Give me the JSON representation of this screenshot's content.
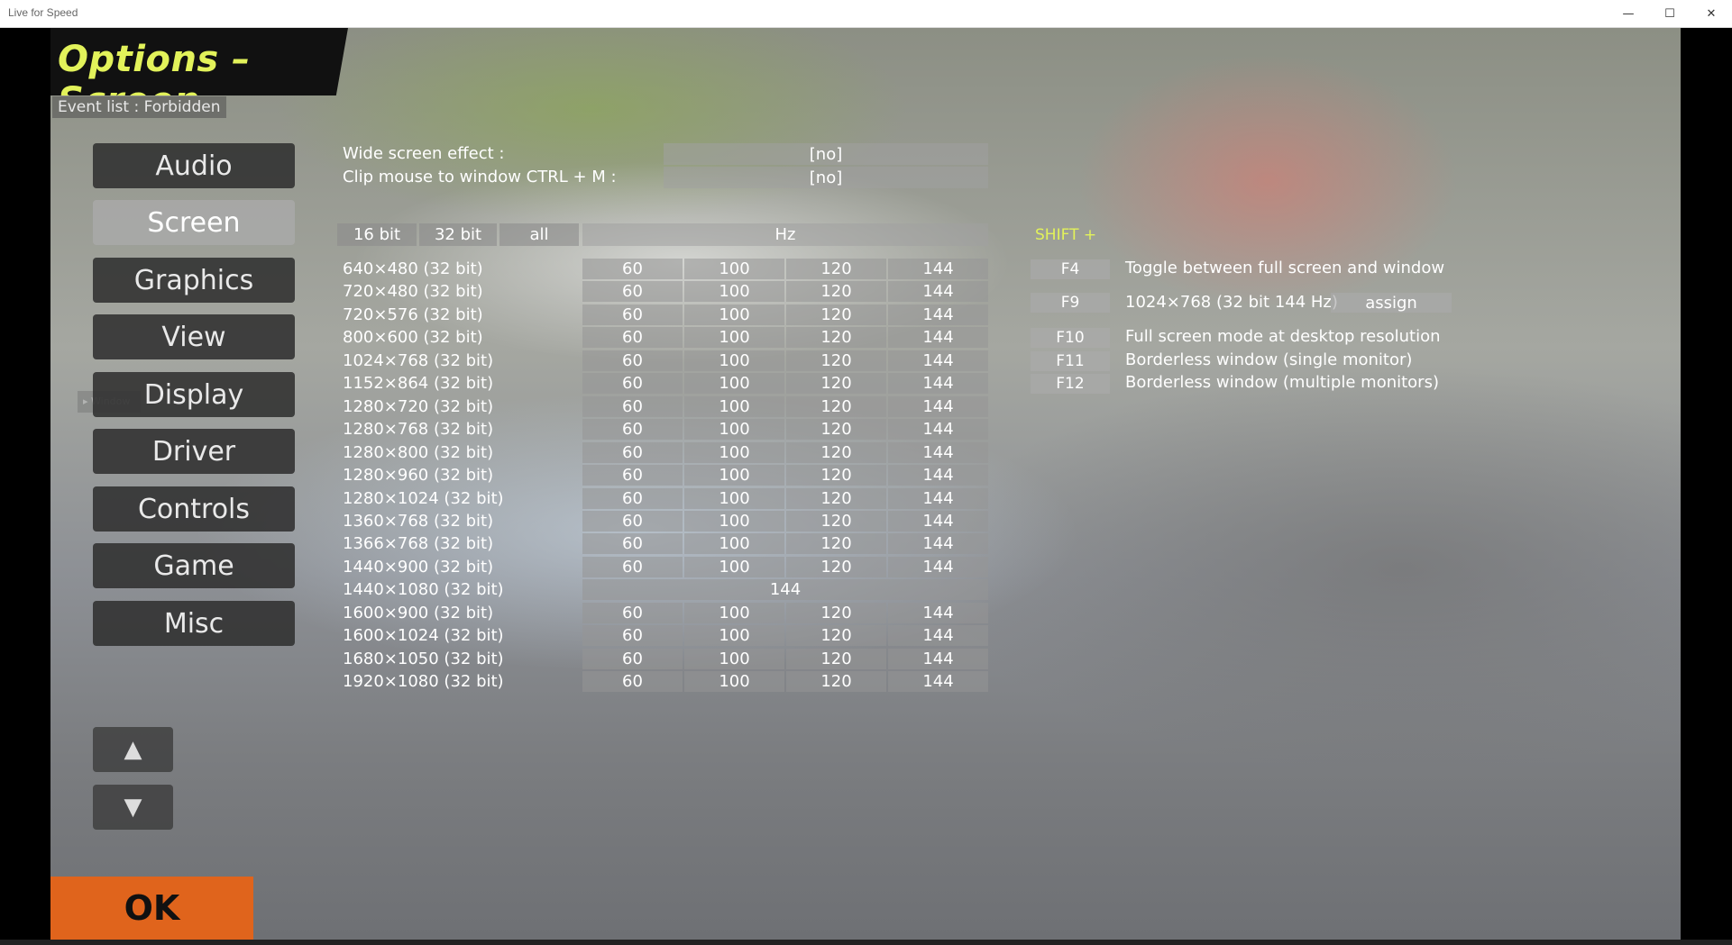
{
  "window": {
    "title": "Live for Speed",
    "minimize": "—",
    "maximize": "☐",
    "close": "✕"
  },
  "header": {
    "title": "Options – Screen",
    "event_list": "Event list : Forbidden"
  },
  "sidebar": {
    "items": [
      {
        "label": "Audio",
        "active": false
      },
      {
        "label": "Screen",
        "active": true
      },
      {
        "label": "Graphics",
        "active": false
      },
      {
        "label": "View",
        "active": false
      },
      {
        "label": "Display",
        "active": false
      },
      {
        "label": "Driver",
        "active": false
      },
      {
        "label": "Controls",
        "active": false
      },
      {
        "label": "Game",
        "active": false
      },
      {
        "label": "Misc",
        "active": false
      }
    ],
    "up_arrow": "▲",
    "down_arrow": "▼",
    "ok": "OK"
  },
  "options": {
    "wide_screen": {
      "label": "Wide screen effect :",
      "value": "[no]"
    },
    "clip_mouse": {
      "label": "Clip mouse to window CTRL + M :",
      "value": "[no]"
    }
  },
  "filters": {
    "bit16": "16 bit",
    "bit32": "32 bit",
    "all": "all",
    "hz": "Hz"
  },
  "resolutions": [
    {
      "label": "640×480 (32 bit)",
      "hz": [
        "60",
        "100",
        "120",
        "144"
      ]
    },
    {
      "label": "720×480 (32 bit)",
      "hz": [
        "60",
        "100",
        "120",
        "144"
      ]
    },
    {
      "label": "720×576 (32 bit)",
      "hz": [
        "60",
        "100",
        "120",
        "144"
      ]
    },
    {
      "label": "800×600 (32 bit)",
      "hz": [
        "60",
        "100",
        "120",
        "144"
      ]
    },
    {
      "label": "1024×768 (32 bit)",
      "hz": [
        "60",
        "100",
        "120",
        "144"
      ]
    },
    {
      "label": "1152×864 (32 bit)",
      "hz": [
        "60",
        "100",
        "120",
        "144"
      ]
    },
    {
      "label": "1280×720 (32 bit)",
      "hz": [
        "60",
        "100",
        "120",
        "144"
      ]
    },
    {
      "label": "1280×768 (32 bit)",
      "hz": [
        "60",
        "100",
        "120",
        "144"
      ]
    },
    {
      "label": "1280×800 (32 bit)",
      "hz": [
        "60",
        "100",
        "120",
        "144"
      ]
    },
    {
      "label": "1280×960 (32 bit)",
      "hz": [
        "60",
        "100",
        "120",
        "144"
      ]
    },
    {
      "label": "1280×1024 (32 bit)",
      "hz": [
        "60",
        "100",
        "120",
        "144"
      ]
    },
    {
      "label": "1360×768 (32 bit)",
      "hz": [
        "60",
        "100",
        "120",
        "144"
      ]
    },
    {
      "label": "1366×768 (32 bit)",
      "hz": [
        "60",
        "100",
        "120",
        "144"
      ]
    },
    {
      "label": "1440×900 (32 bit)",
      "hz": [
        "60",
        "100",
        "120",
        "144"
      ]
    },
    {
      "label": "1440×1080 (32 bit)",
      "hz": [
        "144"
      ]
    },
    {
      "label": "1600×900 (32 bit)",
      "hz": [
        "60",
        "100",
        "120",
        "144"
      ]
    },
    {
      "label": "1600×1024 (32 bit)",
      "hz": [
        "60",
        "100",
        "120",
        "144"
      ]
    },
    {
      "label": "1680×1050 (32 bit)",
      "hz": [
        "60",
        "100",
        "120",
        "144"
      ]
    },
    {
      "label": "1920×1080 (32 bit)",
      "hz": [
        "60",
        "100",
        "120",
        "144"
      ]
    }
  ],
  "shortcuts": {
    "shift_label": "SHIFT +",
    "items": [
      {
        "key": "F4",
        "desc": "Toggle between full screen and window"
      },
      {
        "key": "F9",
        "desc": "1024×768 (32 bit 144 Hz)"
      },
      {
        "key": "F10",
        "desc": "Full screen mode at desktop resolution"
      },
      {
        "key": "F11",
        "desc": "Borderless window (single monitor)"
      },
      {
        "key": "F12",
        "desc": "Borderless window (multiple monitors)"
      }
    ],
    "assign": "assign"
  },
  "colors": {
    "accent": "#e2f25a",
    "ok": "#e0641c"
  }
}
